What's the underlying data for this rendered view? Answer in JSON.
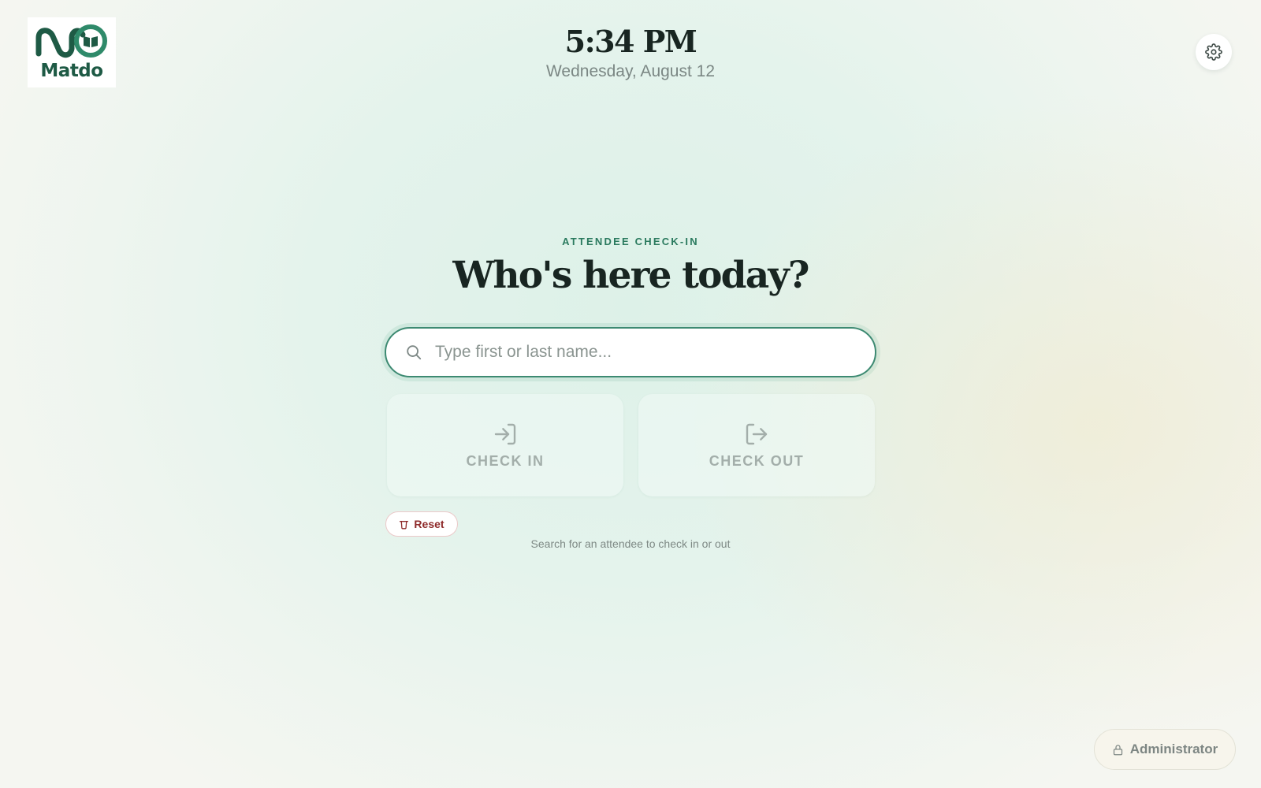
{
  "brand": {
    "name": "Matdo",
    "color": "#1e5a45"
  },
  "clock": {
    "time": "5:34 PM",
    "date": "Wednesday, August 12"
  },
  "settings": {
    "icon": "gear-icon"
  },
  "main": {
    "eyebrow": "ATTENDEE CHECK-IN",
    "headline": "Who's here today?",
    "search": {
      "placeholder": "Type first or last name...",
      "value": "",
      "icon": "search-icon"
    },
    "check_in": {
      "label": "CHECK IN",
      "icon": "login-arrow-icon",
      "enabled": false
    },
    "check_out": {
      "label": "CHECK OUT",
      "icon": "logout-arrow-icon",
      "enabled": false
    },
    "reset": {
      "label": "Reset",
      "icon": "trash-icon",
      "color": "#8e2a2a"
    },
    "hint": "Search for an attendee to check in or out"
  },
  "admin": {
    "label": "Administrator",
    "icon": "lock-icon"
  },
  "colors": {
    "accent": "#2a7a5e",
    "search_border": "#3d8a72",
    "disabled_text": "#a3aeaa"
  }
}
